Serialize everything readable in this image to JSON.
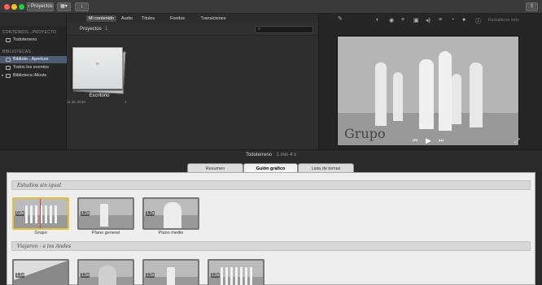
{
  "window": {
    "controls": [
      "#ff5f57",
      "#febc2e",
      "#28c840"
    ],
    "back_label": "Proyectos",
    "grid_icon": "browser-view-icon",
    "import_icon": "import-arrow-icon",
    "share_icon": "share-icon"
  },
  "library": {
    "header_title": "CONTENIDO...PROYECTO",
    "items_top": [
      {
        "label": "Todoterreno",
        "icon": "film-icon"
      }
    ],
    "section_title": "BIBLIOTECAS",
    "items": [
      {
        "label": "Bibliote...Aperture",
        "icon": "photos-library-icon",
        "selected": true
      },
      {
        "label": "Todos los eventos",
        "icon": "events-icon",
        "selected": false
      },
      {
        "label": "Biblioteca iMovie",
        "icon": "imovie-library-icon",
        "selected": false
      }
    ]
  },
  "media_tabs": [
    {
      "label": "Mi contenido",
      "active": true
    },
    {
      "label": "Audio",
      "active": false
    },
    {
      "label": "Títulos",
      "active": false
    },
    {
      "label": "Fondos",
      "active": false
    },
    {
      "label": "Transiciones",
      "active": false
    }
  ],
  "browser": {
    "header_label": "Proyectos",
    "header_count": "1",
    "search_placeholder": "",
    "project": {
      "name": "Escritorio",
      "date": "11 dic 2015",
      "count": "1"
    }
  },
  "viewer": {
    "tools": [
      "magic-wand-icon",
      "color-balance-icon",
      "color-correction-icon",
      "crop-icon",
      "stabilization-icon",
      "volume-icon",
      "noise-reduction-icon",
      "speed-icon",
      "filter-icon",
      "info-icon"
    ],
    "reset_label": "Restablecer todo",
    "title_text": "Grupo",
    "controls": [
      "skip-back-icon",
      "play-icon",
      "skip-forward-icon"
    ],
    "fullscreen_icon": "fullscreen-icon"
  },
  "project_bar": {
    "name": "Todoterreno",
    "duration": "1 min 4 s"
  },
  "tabs": [
    {
      "label": "Resumen",
      "active": false
    },
    {
      "label": "Guión gráfico",
      "active": true
    },
    {
      "label": "Lista de tomas",
      "active": false
    }
  ],
  "sections": [
    {
      "title": "Estudios sin igual",
      "clips": [
        {
          "duration": "0,8s",
          "label": "Grupo",
          "selected": true
        },
        {
          "duration": "1,2s",
          "label": "Plano general",
          "selected": false
        },
        {
          "duration": "1,7s",
          "label": "Plano medio",
          "selected": false
        }
      ]
    },
    {
      "title": "Viajaron - a los Andes",
      "clips": [
        {
          "duration": "1,1s",
          "label": "",
          "selected": false
        },
        {
          "duration": "1,5s",
          "label": "",
          "selected": false
        },
        {
          "duration": "1,5s",
          "label": "",
          "selected": false
        },
        {
          "duration": "1,0s",
          "label": "",
          "selected": false
        }
      ]
    }
  ]
}
